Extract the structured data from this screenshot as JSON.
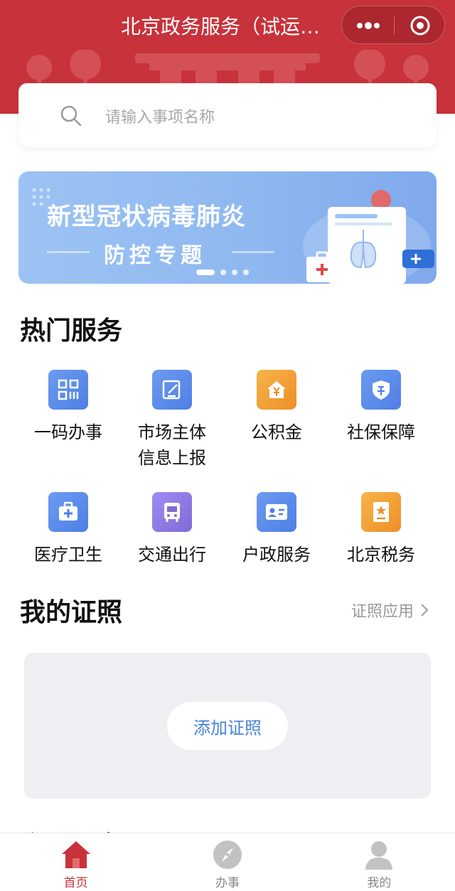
{
  "header": {
    "title": "北京政务服务（试运行）"
  },
  "search": {
    "placeholder": "请输入事项名称"
  },
  "banner": {
    "title": "新型冠状病毒肺炎",
    "subtitle": "防控专题",
    "slide_count": 4,
    "active_slide": 1
  },
  "hot_services": {
    "title": "热门服务",
    "items": [
      {
        "label": "一码办事",
        "icon": "qr-code-icon",
        "color": "#5b8def"
      },
      {
        "label": "市场主体\n信息上报",
        "icon": "edit-document-icon",
        "color": "#4e86e8"
      },
      {
        "label": "公积金",
        "icon": "house-yuan-icon",
        "color": "#f0a030"
      },
      {
        "label": "社保保障",
        "icon": "shield-icon",
        "color": "#4e86e8"
      },
      {
        "label": "医疗卫生",
        "icon": "medical-kit-icon",
        "color": "#4e86e8"
      },
      {
        "label": "交通出行",
        "icon": "bus-icon",
        "color": "#8f7ae0"
      },
      {
        "label": "户政服务",
        "icon": "id-card-icon",
        "color": "#4e86e8"
      },
      {
        "label": "北京税务",
        "icon": "tax-book-icon",
        "color": "#f0a030"
      }
    ]
  },
  "certificates": {
    "title": "我的证照",
    "link_label": "证照应用",
    "add_label": "添加证照"
  },
  "hidden_section": {
    "title": "主题服务"
  },
  "tabbar": {
    "items": [
      {
        "label": "首页",
        "active": true
      },
      {
        "label": "办事",
        "active": false
      },
      {
        "label": "我的",
        "active": false
      }
    ]
  },
  "colors": {
    "brand_red": "#c8323a",
    "link_blue": "#4a82d6"
  }
}
